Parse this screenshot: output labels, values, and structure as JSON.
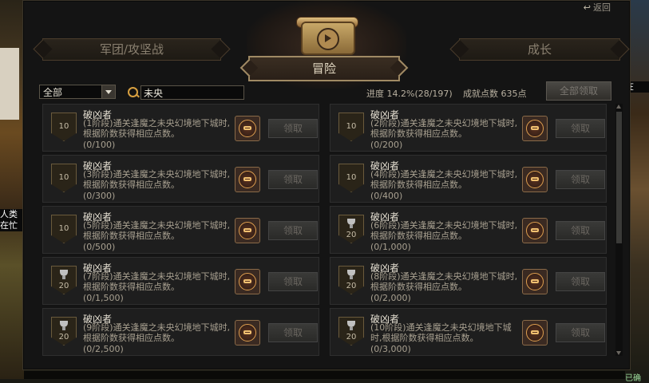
{
  "background": {
    "left_label": "人类\n在忙",
    "right_label": "在",
    "right_bottom": "已确"
  },
  "header": {
    "back_label": "返回"
  },
  "tabs": {
    "legion": "军团/攻坚战",
    "adventure": "冒险",
    "growth": "成长"
  },
  "toolbar": {
    "filter_value": "全部",
    "search_value": "未央",
    "progress_text": "进度 14.2%(28/197)",
    "points_text": "成就点数 635点",
    "claim_all_label": "全部领取"
  },
  "cards": [
    {
      "name": "破凶者",
      "desc": "(1阶段)通关逢魔之未央幻境地下城时,根据阶数获得相应点数。",
      "progress": "(0/100)",
      "level": "10",
      "trophy": false,
      "claim": "领取"
    },
    {
      "name": "破凶者",
      "desc": "(2阶段)通关逢魔之未央幻境地下城时,根据阶数获得相应点数。",
      "progress": "(0/200)",
      "level": "10",
      "trophy": false,
      "claim": "领取"
    },
    {
      "name": "破凶者",
      "desc": "(3阶段)通关逢魔之未央幻境地下城时,根据阶数获得相应点数。",
      "progress": "(0/300)",
      "level": "10",
      "trophy": false,
      "claim": "领取"
    },
    {
      "name": "破凶者",
      "desc": "(4阶段)通关逢魔之未央幻境地下城时,根据阶数获得相应点数。",
      "progress": "(0/400)",
      "level": "10",
      "trophy": false,
      "claim": "领取"
    },
    {
      "name": "破凶者",
      "desc": "(5阶段)通关逢魔之未央幻境地下城时,根据阶数获得相应点数。",
      "progress": "(0/500)",
      "level": "10",
      "trophy": false,
      "claim": "领取"
    },
    {
      "name": "破凶者",
      "desc": "(6阶段)通关逢魔之未央幻境地下城时,根据阶数获得相应点数。",
      "progress": "(0/1,000)",
      "level": "20",
      "trophy": true,
      "claim": "领取"
    },
    {
      "name": "破凶者",
      "desc": "(7阶段)通关逢魔之未央幻境地下城时,根据阶数获得相应点数。",
      "progress": "(0/1,500)",
      "level": "20",
      "trophy": true,
      "claim": "领取"
    },
    {
      "name": "破凶者",
      "desc": "(8阶段)通关逢魔之未央幻境地下城时,根据阶数获得相应点数。",
      "progress": "(0/2,000)",
      "level": "20",
      "trophy": true,
      "claim": "领取"
    },
    {
      "name": "破凶者",
      "desc": "(9阶段)通关逢魔之未央幻境地下城时,根据阶数获得相应点数。",
      "progress": "(0/2,500)",
      "level": "20",
      "trophy": true,
      "claim": "领取"
    },
    {
      "name": "破凶者",
      "desc": "(10阶段)通关逢魔之未央幻境地下城时,根据阶数获得相应点数。",
      "progress": "(0/3,000)",
      "level": "20",
      "trophy": true,
      "claim": "领取"
    }
  ],
  "icons": {
    "badge": "achievement-emblem-icon",
    "search": "search-icon",
    "back": "return-arrow-icon",
    "header": "scroll-compass-icon"
  }
}
